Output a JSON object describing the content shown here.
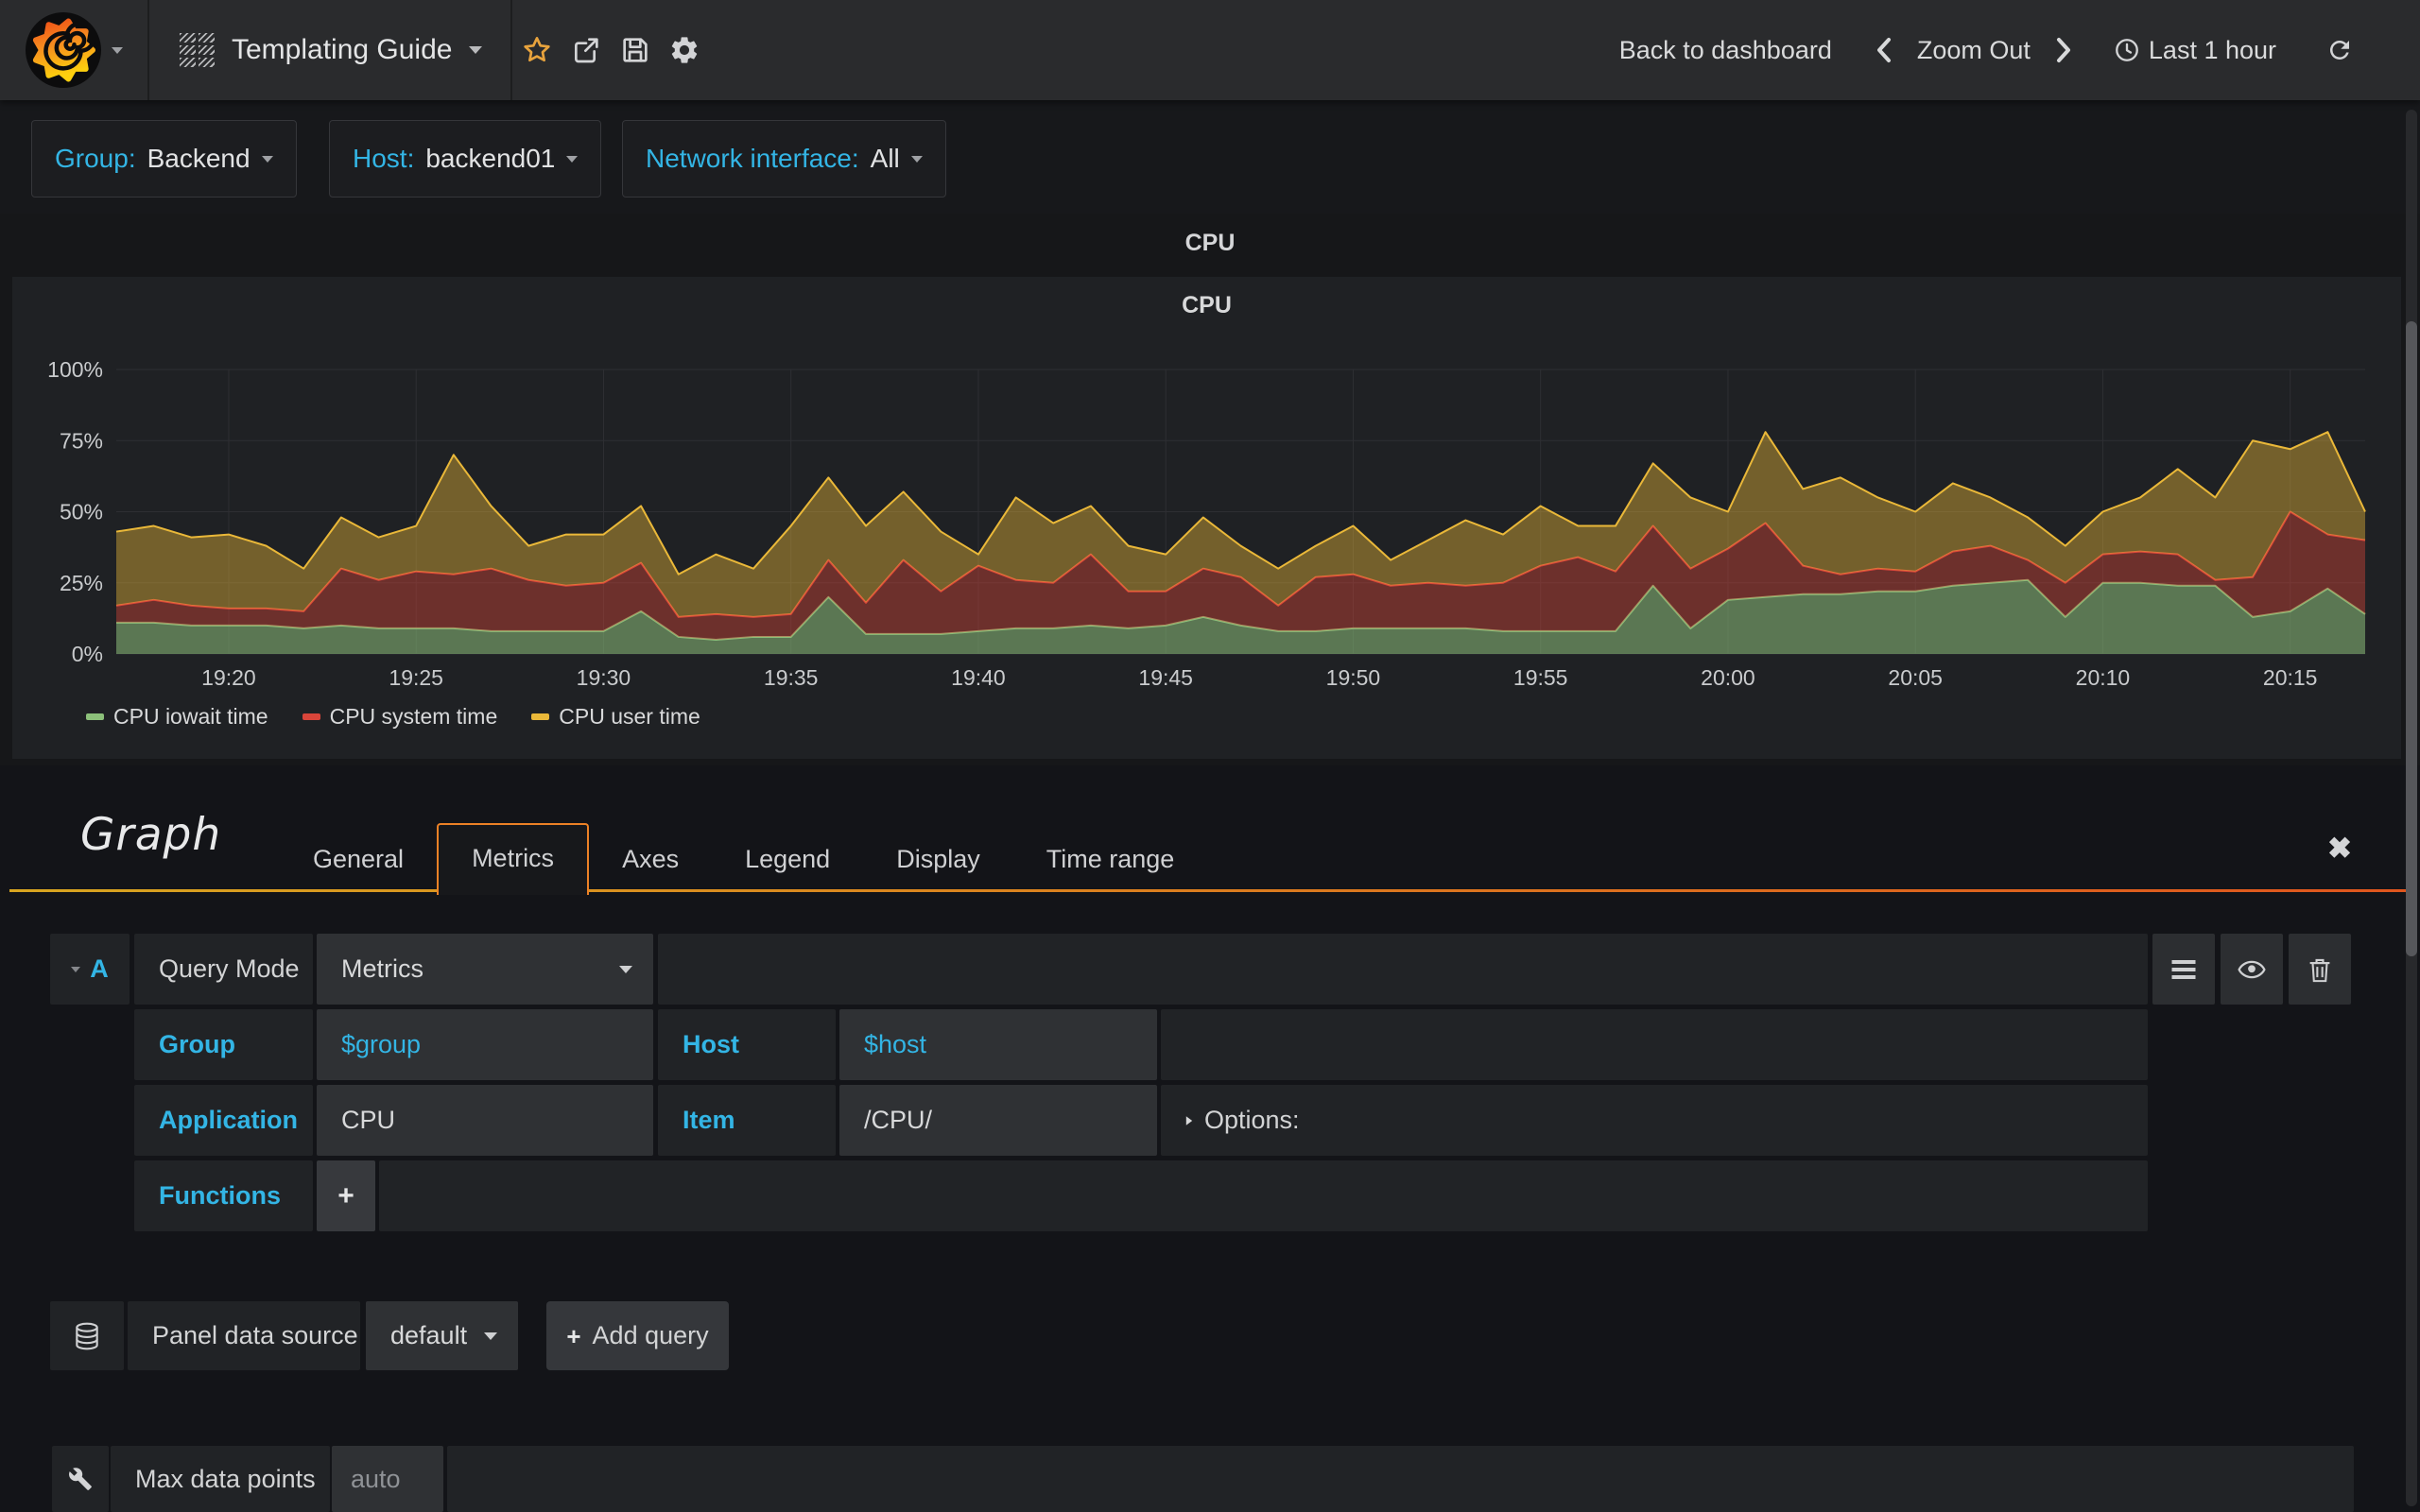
{
  "navbar": {
    "dashboard_title": "Templating Guide",
    "back_to_dashboard": "Back to dashboard",
    "zoom_out": "Zoom Out",
    "time_range": "Last 1 hour"
  },
  "icons": {
    "logo": "grafana-logo",
    "dashboard_picker": "grid-icon",
    "favorite": "star-icon",
    "share": "share-icon",
    "save": "floppy-icon",
    "settings": "gear-icon",
    "shift_back": "chevron-left-icon",
    "shift_forward": "chevron-right-icon",
    "time": "clock-icon",
    "refresh": "refresh-icon",
    "close_editor": "close-icon",
    "query_menu": "menu-icon",
    "query_visibility": "eye-icon",
    "query_delete": "trash-icon",
    "datasource": "database-icon",
    "panel_settings": "wrench-icon",
    "collapse_query": "caret-down-icon",
    "expand_options": "caret-right-icon"
  },
  "template_variables": [
    {
      "label": "Group:",
      "value": "Backend"
    },
    {
      "label": "Host:",
      "value": "backend01"
    },
    {
      "label": "Network interface:",
      "value": "All"
    }
  ],
  "row_title": "CPU",
  "panel_title": "CPU",
  "chart_data": {
    "type": "area",
    "stacked": true,
    "title": "CPU",
    "ylabel": "",
    "ylim": [
      0,
      100
    ],
    "yticks": [
      0,
      25,
      50,
      75,
      100
    ],
    "ytick_suffix": "%",
    "xtick_labels": [
      "19:20",
      "19:25",
      "19:30",
      "19:35",
      "19:40",
      "19:45",
      "19:50",
      "19:55",
      "20:00",
      "20:05",
      "20:10",
      "20:15"
    ],
    "xtick_minutes": [
      3,
      8,
      13,
      18,
      23,
      28,
      33,
      38,
      43,
      48,
      53,
      58
    ],
    "x_start": "19:17",
    "x_end": "20:17",
    "x_total_minutes": 60,
    "grid": true,
    "legend_position": "bottom",
    "series": [
      {
        "name": "CPU iowait time",
        "color": "#8CC07A",
        "fill_opacity": 0.55,
        "values": [
          11,
          11,
          10,
          10,
          10,
          9,
          10,
          9,
          9,
          9,
          8,
          8,
          8,
          8,
          15,
          6,
          5,
          6,
          6,
          20,
          7,
          7,
          7,
          8,
          9,
          9,
          10,
          9,
          10,
          13,
          10,
          8,
          8,
          9,
          9,
          9,
          9,
          8,
          8,
          8,
          8,
          24,
          9,
          19,
          20,
          21,
          21,
          22,
          22,
          24,
          25,
          26,
          13,
          25,
          25,
          24,
          24,
          13,
          15,
          23,
          14
        ]
      },
      {
        "name": "CPU system time",
        "color": "#D9453A",
        "fill_opacity": 0.42,
        "values": [
          6,
          8,
          7,
          6,
          6,
          6,
          20,
          17,
          20,
          19,
          22,
          18,
          16,
          17,
          17,
          7,
          9,
          7,
          8,
          13,
          11,
          26,
          15,
          23,
          17,
          16,
          25,
          13,
          12,
          17,
          17,
          9,
          19,
          19,
          15,
          16,
          15,
          17,
          23,
          26,
          21,
          21,
          21,
          18,
          26,
          10,
          7,
          8,
          7,
          12,
          13,
          7,
          12,
          10,
          11,
          11,
          2,
          14,
          35,
          19,
          26
        ]
      },
      {
        "name": "CPU user time",
        "color": "#EAB839",
        "fill_opacity": 0.42,
        "values": [
          26,
          26,
          24,
          26,
          22,
          15,
          18,
          15,
          16,
          42,
          22,
          12,
          18,
          17,
          20,
          15,
          21,
          17,
          31,
          29,
          27,
          24,
          21,
          4,
          29,
          21,
          17,
          16,
          13,
          18,
          11,
          13,
          11,
          17,
          9,
          15,
          23,
          17,
          21,
          11,
          16,
          22,
          25,
          13,
          32,
          27,
          34,
          25,
          21,
          24,
          17,
          15,
          13,
          15,
          19,
          30,
          29,
          48,
          22,
          36,
          10
        ]
      }
    ]
  },
  "editor": {
    "panel_type_title": "Graph",
    "tabs": [
      "General",
      "Metrics",
      "Axes",
      "Legend",
      "Display",
      "Time range"
    ],
    "active_tab": "Metrics",
    "query": {
      "ref_letter": "A",
      "query_mode_label": "Query Mode",
      "query_mode_value": "Metrics",
      "group_label": "Group",
      "group_value": "$group",
      "host_label": "Host",
      "host_value": "$host",
      "application_label": "Application",
      "application_value": "CPU",
      "item_label": "Item",
      "item_value": "/CPU/",
      "options_label": "Options:",
      "functions_label": "Functions",
      "add_function_label": "+"
    },
    "datasource": {
      "label": "Panel data source",
      "value": "default",
      "add_query_plus": "+",
      "add_query_label": "Add query"
    },
    "max_data_points": {
      "label": "Max data points",
      "placeholder": "auto"
    }
  },
  "colors": {
    "accent_blue": "#33b5e5",
    "accent_yellow": "#eab839",
    "tab_border_orange": "#ec8126"
  }
}
